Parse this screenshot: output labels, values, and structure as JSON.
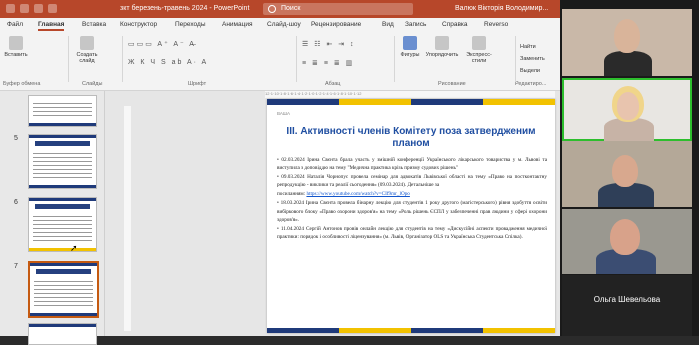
{
  "titlebar": {
    "doc_title": "зкт березень-травень 2024 - PowerPoint",
    "search_placeholder": "Поиск",
    "user_name": "Валюк Вікторія Володимир...",
    "close_glyph": "✕"
  },
  "ribbon": {
    "tabs": [
      "Файл",
      "Главная",
      "Вставка",
      "Конструктор",
      "Переходы",
      "Анимация",
      "Слайд-шоу",
      "Рецензирование",
      "Вид",
      "Запись",
      "Справка",
      "Reverso"
    ],
    "active_tab": "Главная",
    "buttons": {
      "paste": "Вставить",
      "new_slide": "Создать слайд",
      "shapes": "Фигуры",
      "arrange": "Упорядочить",
      "quick_styles": "Экспресс-стили",
      "find": "Найти",
      "replace": "Заменить",
      "select": "Выдели"
    },
    "groups": [
      "Буфер обмена",
      "Слайды",
      "Шрифт",
      "Абзац",
      "Рисование",
      "Редактиро..."
    ]
  },
  "thumbnails": {
    "slide_numbers": [
      "5",
      "6",
      "7"
    ]
  },
  "ruler_text": "12·1·10·1·8·1·6·1·4·1·2·1·0·1·2·1·4·1·6·1·8·1·10·1·12",
  "slide": {
    "header_small": "ВАША",
    "title": "III. Активності членів Комітету поза затвердженим планом",
    "paragraphs": [
      "•  02.03.2024 Ірина Свєнта брала участь у змішній конференції Українського лікарського товариства у м. Львові та виступила з доповіддю на тему \"Медична практика крізь призму судових рішень\"",
      "•  09.03.2024 Наталія Чорнопус провела семінар для адвокатів Львівської області на тему «Право на постконтактну репродукцію - виклики та реалії сьогодення»              (09.03.2024).              Детальніше              за",
      "•  18.03.2024 Ірина Свєнта провела бінарну лекцію для студентів 1 року другого (магістерського) рівня здобуття освіти вибіркового блоку «Право охорони здоров'я» на тему «Роль рішень ЄСПЛ у забезпеченні прав людини у сфері охорони здоров'я».",
      "•  11.04.2024 Сергій Антонов провів онлайн лекцію для студентів на тему «Дискусійні аспекти провадження медичної практики: порядок і особливості ліцензування» (м. Львів, Організатор OLS та Українська Студентська Спілка)."
    ],
    "link_prefix": "посиланням: ",
    "link_text": "https://www.youtube.com/watch?v=CIf9mr_lOpo",
    "colors": {
      "blue": "#1f3a7a",
      "yellow": "#f2c200",
      "title": "#1f4ea1"
    }
  },
  "video": {
    "participant_name": "Ольга Шевельова",
    "active_speaker_color": "#2dbe2d"
  }
}
